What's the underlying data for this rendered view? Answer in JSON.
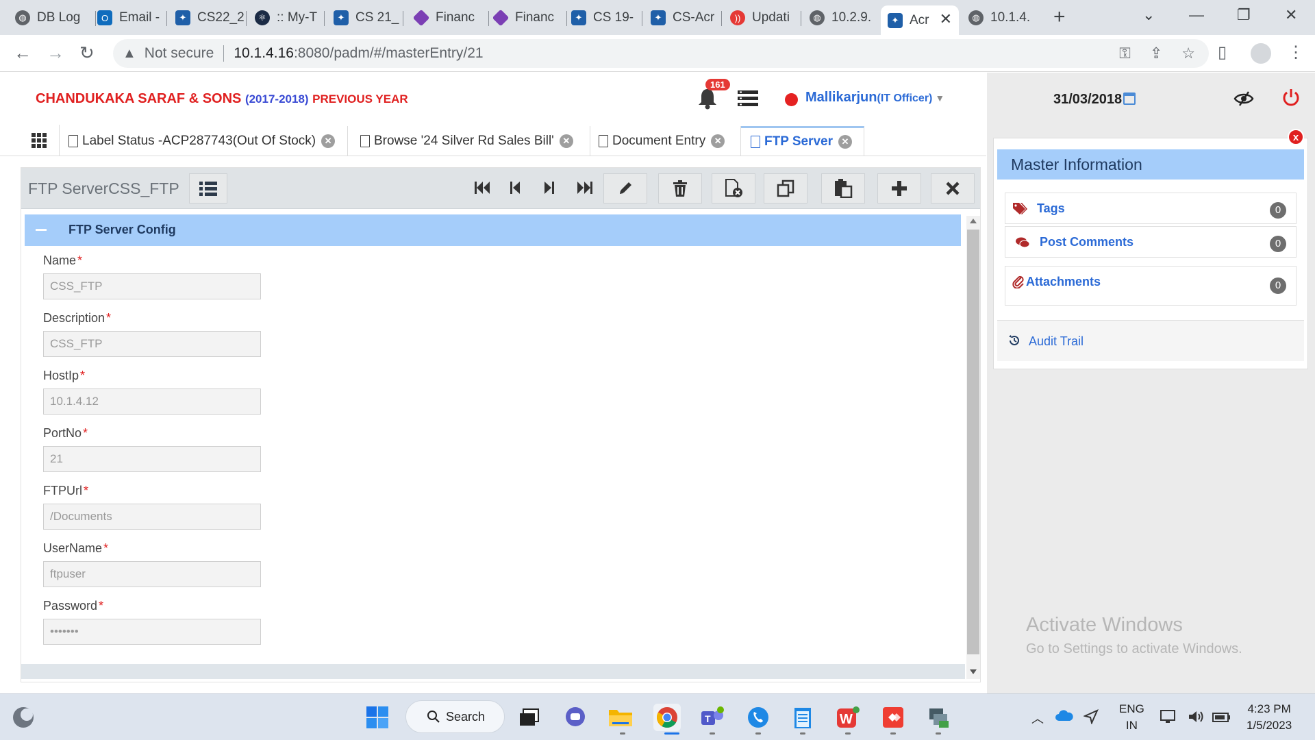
{
  "browser": {
    "tabs": [
      {
        "label": "DB Log",
        "icon": "globe-icon"
      },
      {
        "label": "Email -",
        "icon": "outlook-icon"
      },
      {
        "label": "CS22_2",
        "icon": "app-icon"
      },
      {
        "label": ":: My-T",
        "icon": "react-icon"
      },
      {
        "label": "CS 21_",
        "icon": "app-icon"
      },
      {
        "label": "Financ",
        "icon": "diamond-icon"
      },
      {
        "label": "Financ",
        "icon": "diamond-icon"
      },
      {
        "label": "CS 19-",
        "icon": "app-icon"
      },
      {
        "label": "CS-Acr",
        "icon": "app-icon"
      },
      {
        "label": "Updati",
        "icon": "signal-icon"
      },
      {
        "label": "10.2.9.",
        "icon": "globe-icon"
      },
      {
        "label": "Acr",
        "icon": "app-icon",
        "active": true
      },
      {
        "label": "10.1.4.",
        "icon": "globe-icon"
      }
    ],
    "address": {
      "security": "Not secure",
      "host": "10.1.4.16",
      "path": ":8080/padm/#/masterEntry/21"
    }
  },
  "header": {
    "company": "CHANDUKAKA SARAF & SONS",
    "year": "(2017-2018)",
    "period": "PREVIOUS YEAR",
    "notification_count": "161",
    "user_name": "Mallikarjun",
    "user_role": "(IT Officer)",
    "date": "31/03/2018"
  },
  "app_tabs": [
    {
      "label": "Label Status -ACP287743(Out Of Stock)"
    },
    {
      "label": "Browse '24 Silver Rd Sales Bill'"
    },
    {
      "label": "Document Entry"
    },
    {
      "label": "FTP Server",
      "active": true
    }
  ],
  "form": {
    "title": "FTP ServerCSS_FTP",
    "section": "FTP Server Config",
    "fields": [
      {
        "label": "Name",
        "value": "CSS_FTP"
      },
      {
        "label": "Description",
        "value": "CSS_FTP"
      },
      {
        "label": "HostIp",
        "value": "10.1.4.12"
      },
      {
        "label": "PortNo",
        "value": "21"
      },
      {
        "label": "FTPUrl",
        "value": "/Documents"
      },
      {
        "label": "UserName",
        "value": "ftpuser"
      },
      {
        "label": "Password",
        "value": "•••••••"
      }
    ]
  },
  "master_info": {
    "title": "Master Information",
    "items": [
      {
        "label": "Tags",
        "count": "0"
      },
      {
        "label": "Post Comments",
        "count": "0"
      },
      {
        "label": "Attachments",
        "count": "0"
      }
    ],
    "audit": "Audit Trail",
    "close": "x"
  },
  "watermark": {
    "line1": "Activate Windows",
    "line2": "Go to Settings to activate Windows."
  },
  "taskbar": {
    "search": "Search",
    "lang1": "ENG",
    "lang2": "IN",
    "time": "4:23 PM",
    "date": "1/5/2023"
  },
  "colors": {
    "brand_red": "#e02020",
    "link_blue": "#2b6ad6",
    "section_blue": "#a5cdfa"
  }
}
